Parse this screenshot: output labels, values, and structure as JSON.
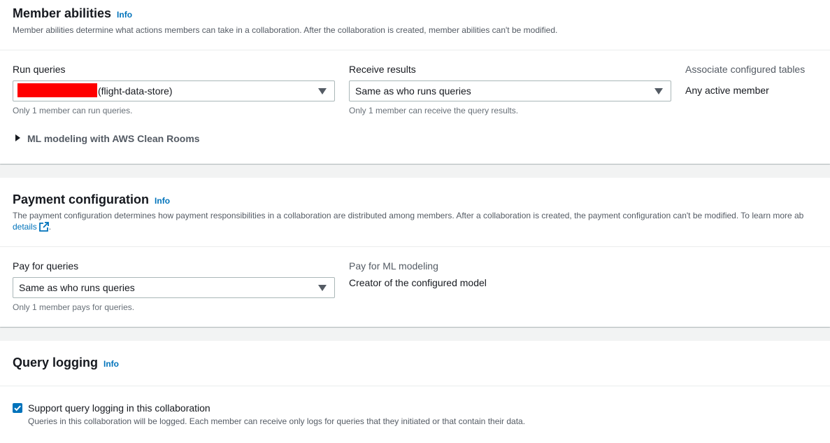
{
  "member_abilities": {
    "title": "Member abilities",
    "info": "Info",
    "description": "Member abilities determine what actions members can take in a collaboration. After the collaboration is created, member abilities can't be modified.",
    "run_queries": {
      "label": "Run queries",
      "selected_value": "(flight-data-store)",
      "hint": "Only 1 member can run queries."
    },
    "receive_results": {
      "label": "Receive results",
      "selected_value": "Same as who runs queries",
      "hint": "Only 1 member can receive the query results."
    },
    "associate_tables": {
      "label": "Associate configured tables",
      "value": "Any active member"
    },
    "ml_modeling_expander": "ML modeling with AWS Clean Rooms"
  },
  "payment_configuration": {
    "title": "Payment configuration",
    "info": "Info",
    "description": "The payment configuration determines how payment responsibilities in a collaboration are distributed among members. After a collaboration is created, the payment configuration can't be modified. To learn more ab",
    "details_link": "details",
    "details_suffix": ".",
    "pay_for_queries": {
      "label": "Pay for queries",
      "selected_value": "Same as who runs queries",
      "hint": "Only 1 member pays for queries."
    },
    "pay_for_ml": {
      "label": "Pay for ML modeling",
      "value": "Creator of the configured model"
    }
  },
  "query_logging": {
    "title": "Query logging",
    "info": "Info",
    "checkbox_label": "Support query logging in this collaboration",
    "checkbox_checked": true,
    "checkbox_description": "Queries in this collaboration will be logged. Each member can receive only logs for queries that they initiated or that contain their data."
  },
  "colors": {
    "link": "#0073bb",
    "redaction": "#ff0000",
    "checkbox": "#0073bb"
  }
}
